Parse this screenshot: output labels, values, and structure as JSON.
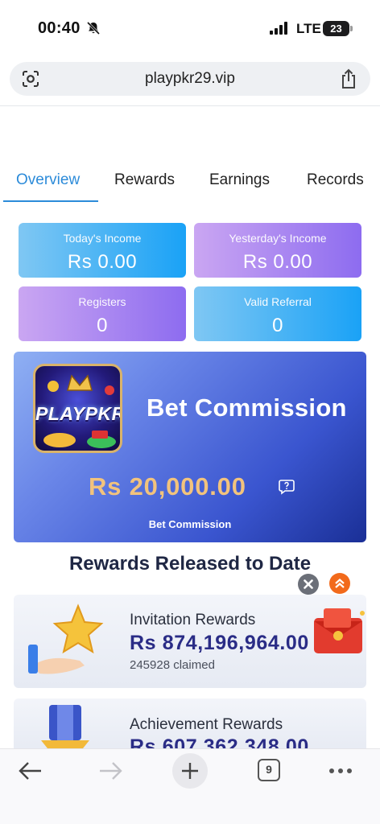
{
  "status_bar": {
    "time": "00:40",
    "network": "LTE",
    "battery": "23"
  },
  "browser": {
    "url": "playpkr29.vip",
    "tab_count": "9"
  },
  "tabs": [
    {
      "label": "Overview",
      "active": true
    },
    {
      "label": "Rewards",
      "active": false
    },
    {
      "label": "Earnings",
      "active": false
    },
    {
      "label": "Records",
      "active": false
    }
  ],
  "stats": [
    {
      "label": "Today's Income",
      "value": "Rs 0.00",
      "style": "blue"
    },
    {
      "label": "Yesterday's Income",
      "value": "Rs 0.00",
      "style": "purple"
    },
    {
      "label": "Registers",
      "value": "0",
      "style": "purple"
    },
    {
      "label": "Valid Referral",
      "value": "0",
      "style": "blue"
    }
  ],
  "bet_commission": {
    "logo_text": "PLAYPKR",
    "title": "Bet Commission",
    "amount": "Rs 20,000.00",
    "subtitle": "Bet Commission"
  },
  "rewards_section": {
    "title": "Rewards Released to Date",
    "items": [
      {
        "name": "Invitation Rewards",
        "amount": "Rs 874,196,964.00",
        "claimed": "245928 claimed"
      },
      {
        "name": "Achievement Rewards",
        "amount": "Rs 607,362,348.00"
      }
    ]
  },
  "colors": {
    "accent": "#2c8bd9",
    "amount_gold": "#f2c37d",
    "reward_amount": "#2a2c86"
  }
}
